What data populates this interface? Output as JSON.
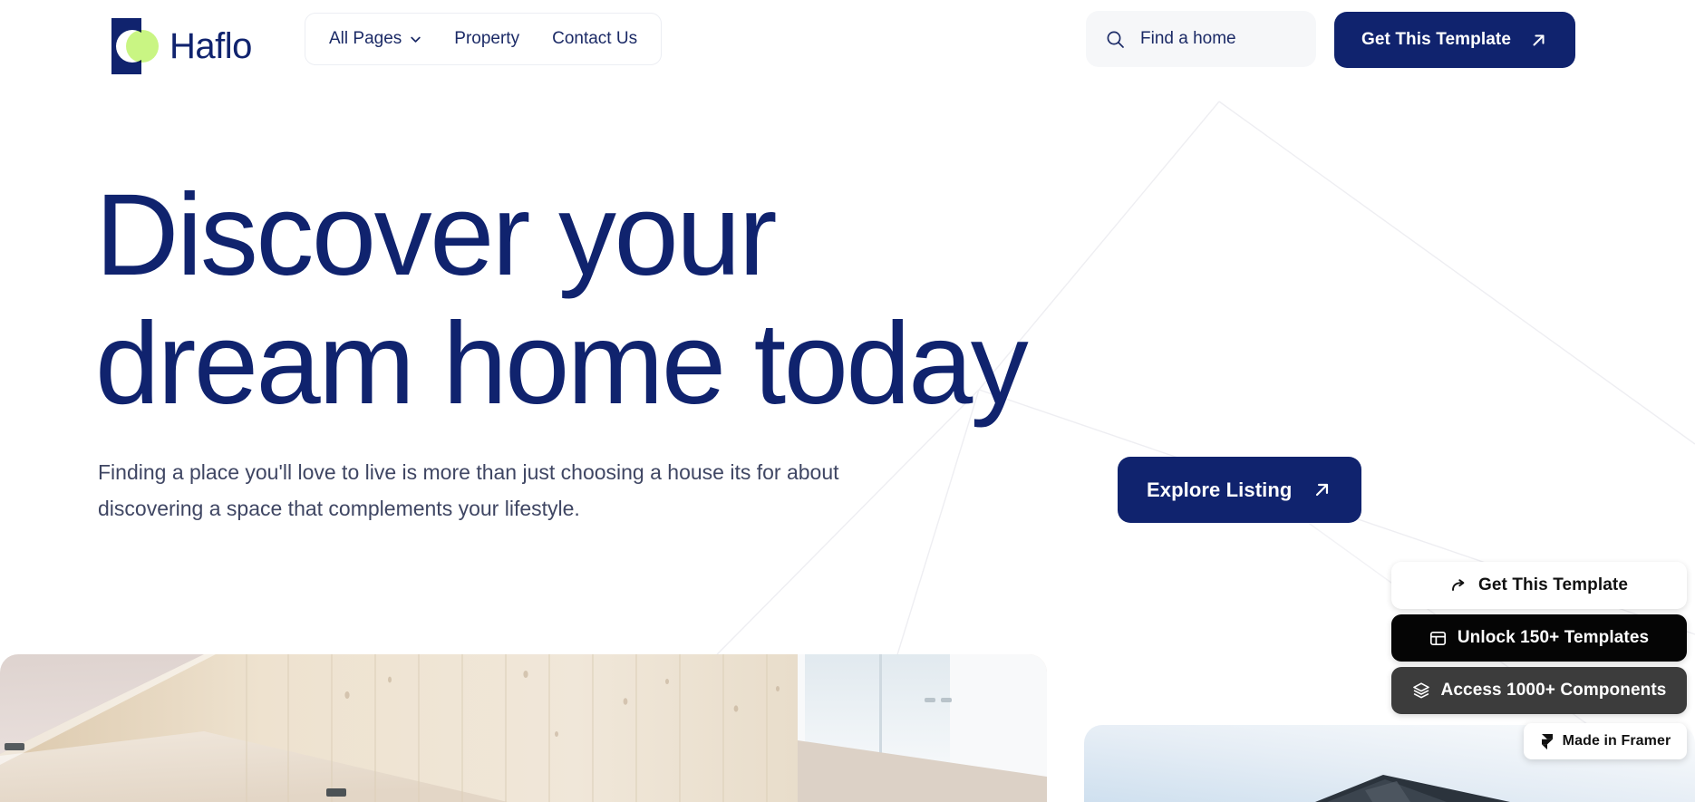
{
  "brand": {
    "name": "Haflo",
    "logo_icon": "haflo-logo-mark",
    "colors": {
      "navy": "#10236e",
      "green": "#c9f583"
    }
  },
  "nav": {
    "items": [
      {
        "label": "All Pages",
        "has_dropdown": true,
        "icon": "chevron-down-icon"
      },
      {
        "label": "Property",
        "has_dropdown": false
      },
      {
        "label": "Contact Us",
        "has_dropdown": false
      }
    ]
  },
  "search": {
    "icon": "search-icon",
    "placeholder": "Find a home",
    "value": "Find a home"
  },
  "header_cta": {
    "label": "Get This Template",
    "icon": "arrow-up-right-icon",
    "bg": "#10236e"
  },
  "hero": {
    "headline_line1": "Discover your",
    "headline_line2": "dream home today",
    "subtext": "Finding a place you'll love to live is more than just choosing a house its for about discovering a space that complements your lifestyle.",
    "cta": {
      "label": "Explore Listing",
      "icon": "arrow-up-right-icon",
      "bg": "#10236e"
    }
  },
  "media": {
    "left_photo_alt": "wood-panelled-interior-hallway",
    "right_photo_alt": "house-roof-against-sky"
  },
  "framer_badges": [
    {
      "label": "Get This Template",
      "icon": "share-arrow-icon",
      "style": "light"
    },
    {
      "label": "Unlock 150+ Templates",
      "icon": "layout-grid-icon",
      "style": "black"
    },
    {
      "label": "Access 1000+ Components",
      "icon": "layers-stack-icon",
      "style": "gray"
    },
    {
      "label": "Made in Framer",
      "icon": "framer-logo-icon",
      "style": "light-small"
    }
  ]
}
